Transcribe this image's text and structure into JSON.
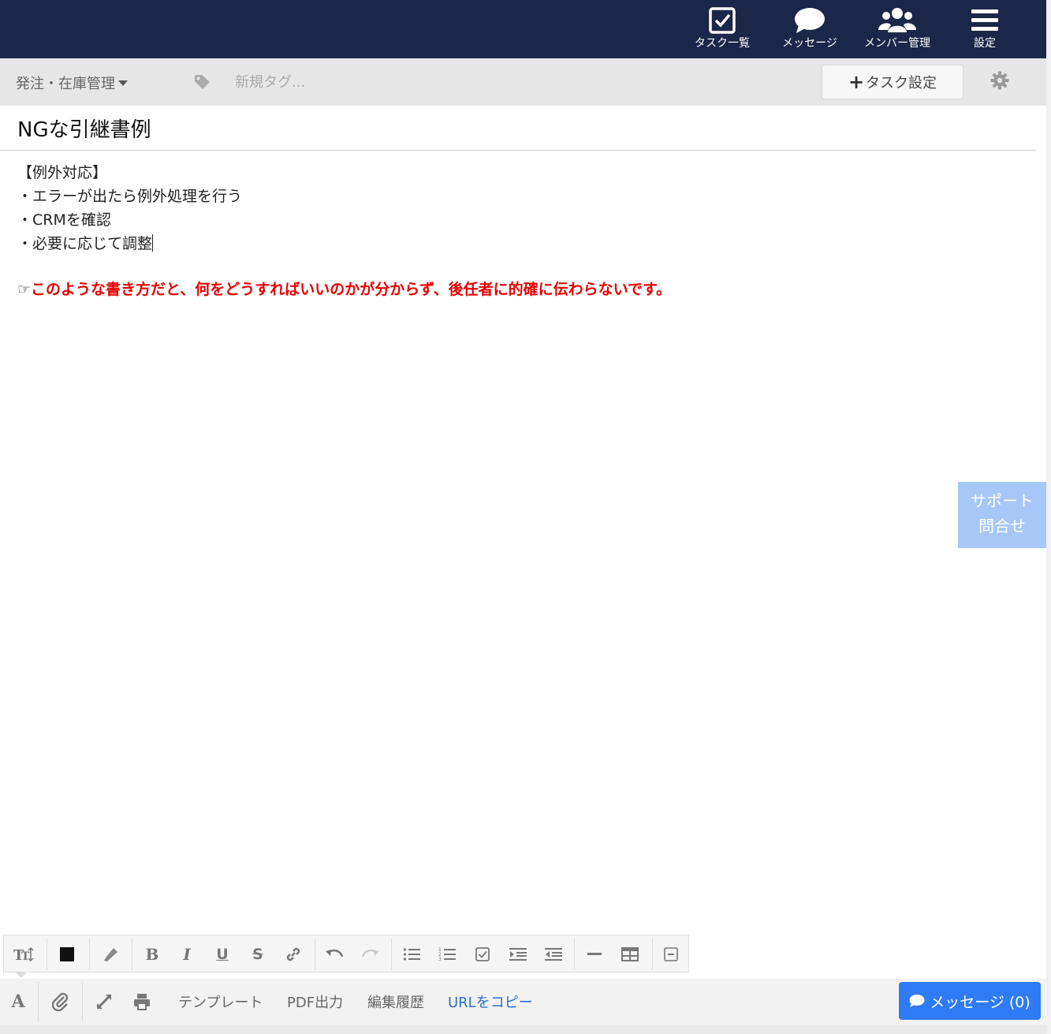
{
  "nav": {
    "items": [
      {
        "label": "タスク一覧",
        "icon": "checkbox-icon"
      },
      {
        "label": "メッセージ",
        "icon": "speech-bubble-icon"
      },
      {
        "label": "メンバー管理",
        "icon": "users-icon"
      },
      {
        "label": "設定",
        "icon": "hamburger-menu-icon"
      }
    ],
    "bg_color": "#1b2748"
  },
  "subbar": {
    "category": "発注・在庫管理",
    "tag_placeholder": "新規タグ...",
    "task_settings_label": "タスク設定"
  },
  "task": {
    "title": "NGな引継書例",
    "lines": [
      "【例外対応】",
      "・エラーが出たら例外処理を行う",
      "・CRMを確認",
      "・必要に応じて調整"
    ],
    "warning_prefix": "☞",
    "warning": "このような書き方だと、何をどうすればいいのかが分からず、後任者に的確に伝わらないです。",
    "warning_color": "#e60000"
  },
  "support": {
    "line1": "サポート",
    "line2": "問合せ"
  },
  "bottombar": {
    "links": [
      "テンプレート",
      "PDF出力",
      "編集履歴",
      "URLをコピー"
    ],
    "message_button": "メッセージ (0)",
    "accent_color": "#2f7bf5"
  }
}
